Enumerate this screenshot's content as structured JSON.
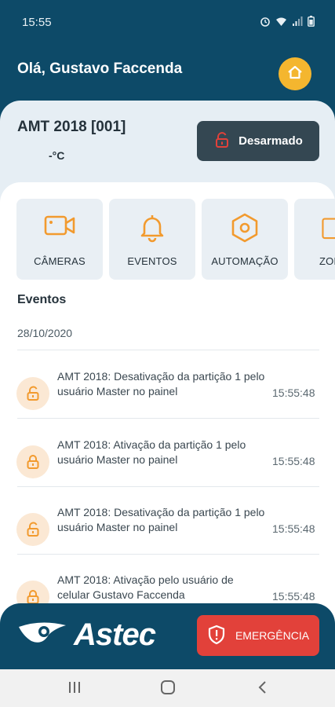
{
  "status_bar": {
    "time": "15:55"
  },
  "header": {
    "greeting": "Olá, Gustavo Faccenda"
  },
  "device": {
    "name": "AMT 2018 [001]",
    "temperature": "-°C",
    "arm_state_label": "Desarmado"
  },
  "shortcuts": [
    {
      "label": "CÂMERAS",
      "icon": "camera-icon"
    },
    {
      "label": "EVENTOS",
      "icon": "bell-icon"
    },
    {
      "label": "AUTOMAÇÃO",
      "icon": "hexagon-icon"
    },
    {
      "label": "ZON",
      "icon": "zone-icon"
    }
  ],
  "events": {
    "title": "Eventos",
    "date": "28/10/2020",
    "items": [
      {
        "text": "AMT 2018: Desativação da partição 1 pelo usuário Master no painel",
        "time": "15:55:48",
        "icon": "unlock-icon"
      },
      {
        "text": "AMT 2018: Ativação da partição 1 pelo usuário Master no painel",
        "time": "15:55:48",
        "icon": "lock-icon"
      },
      {
        "text": "AMT 2018: Desativação da partição 1 pelo usuário Master no painel",
        "time": "15:55:48",
        "icon": "unlock-icon"
      },
      {
        "text": "AMT 2018: Ativação pelo usuário de celular Gustavo Faccenda",
        "time": "15:55:48",
        "icon": "lock-icon"
      }
    ]
  },
  "footer": {
    "brand": "Astec",
    "emergency_label": "EMERGÊNCIA"
  },
  "colors": {
    "primary": "#0d4a68",
    "accent": "#f4b62f",
    "icon_orange": "#f29a2e",
    "emergency": "#e2413a",
    "disarm_bg": "#344752"
  }
}
